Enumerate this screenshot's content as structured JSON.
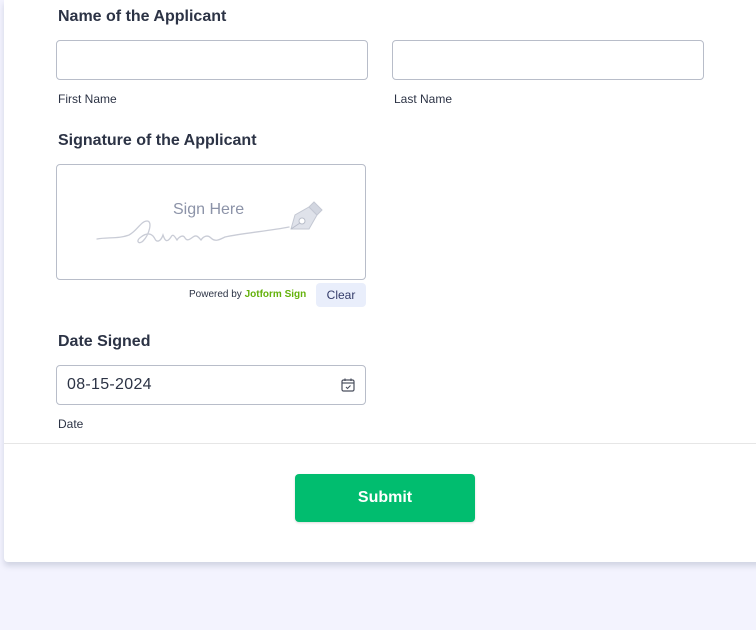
{
  "name_section": {
    "label": "Name of the Applicant",
    "first_name": {
      "value": "",
      "sublabel": "First Name"
    },
    "last_name": {
      "value": "",
      "sublabel": "Last Name"
    }
  },
  "signature_section": {
    "label": "Signature of the Applicant",
    "placeholder": "Sign Here",
    "powered_prefix": "Powered by",
    "powered_brand": "Jotform Sign",
    "clear_label": "Clear"
  },
  "date_section": {
    "label": "Date Signed",
    "value": "08-15-2024",
    "sublabel": "Date",
    "icon": "calendar-icon"
  },
  "submit": {
    "label": "Submit"
  },
  "colors": {
    "page_background": "#f3f3fe",
    "submit_green": "#01bd6f",
    "brand_green": "#64b20c",
    "text": "#2c3345"
  }
}
